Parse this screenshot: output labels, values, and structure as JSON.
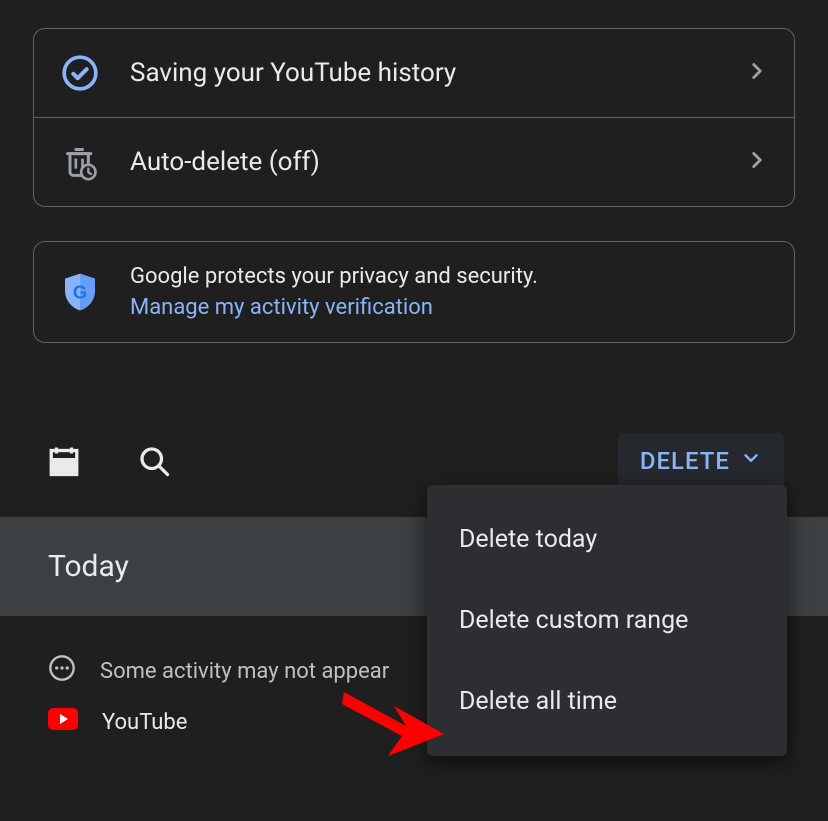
{
  "settings": {
    "saving_label": "Saving your YouTube history",
    "autodelete_label": "Auto-delete (off)"
  },
  "privacy": {
    "line1": "Google protects your privacy and security.",
    "line2": "Manage my activity verification"
  },
  "toolbar": {
    "delete_label": "DELETE"
  },
  "section": {
    "today": "Today"
  },
  "activity": {
    "notice": "Some activity may not appear",
    "app_name": "YouTube"
  },
  "delete_menu": {
    "today": "Delete today",
    "custom": "Delete custom range",
    "all": "Delete all time"
  }
}
